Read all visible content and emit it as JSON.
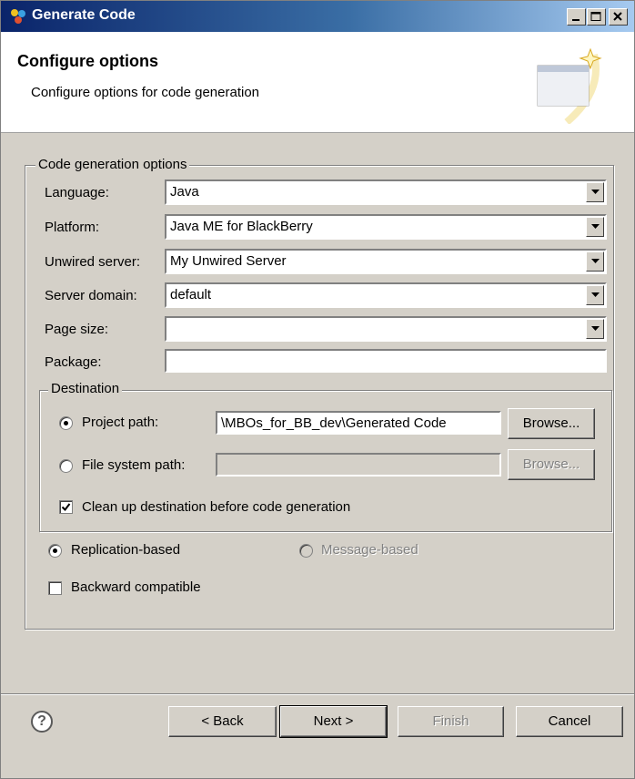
{
  "window": {
    "title": "Generate Code",
    "minimize_label": "",
    "maximize_label": "",
    "close_label": ""
  },
  "header": {
    "title": "Configure options",
    "subtitle": "Configure options for code generation"
  },
  "options": {
    "group_label": "Code generation options",
    "language": {
      "label": "Language:",
      "value": "Java"
    },
    "platform": {
      "label": "Platform:",
      "value": "Java ME for BlackBerry"
    },
    "server": {
      "label": "Unwired server:",
      "value": "My Unwired Server"
    },
    "domain": {
      "label": "Server domain:",
      "value": "default"
    },
    "page_size": {
      "label": "Page size:",
      "value": ""
    },
    "package": {
      "label": "Package:",
      "value": ""
    }
  },
  "destination": {
    "group_label": "Destination",
    "project_path": {
      "label": "Project path:",
      "value": "\\MBOs_for_BB_dev\\Generated Code",
      "selected": true
    },
    "file_system_path": {
      "label": "File system path:",
      "value": "",
      "selected": false
    },
    "browse_label": "Browse...",
    "cleanup": {
      "label": "Clean up destination before code generation",
      "checked": true
    }
  },
  "mode": {
    "replication": {
      "label": "Replication-based",
      "selected": true
    },
    "message": {
      "label": "Message-based",
      "selected": false,
      "enabled": false
    }
  },
  "backward": {
    "label": "Backward compatible",
    "checked": false
  },
  "footer": {
    "help_icon": "help-icon",
    "back_label": "< Back",
    "next_label": "Next >",
    "finish_label": "Finish",
    "cancel_label": "Cancel"
  }
}
